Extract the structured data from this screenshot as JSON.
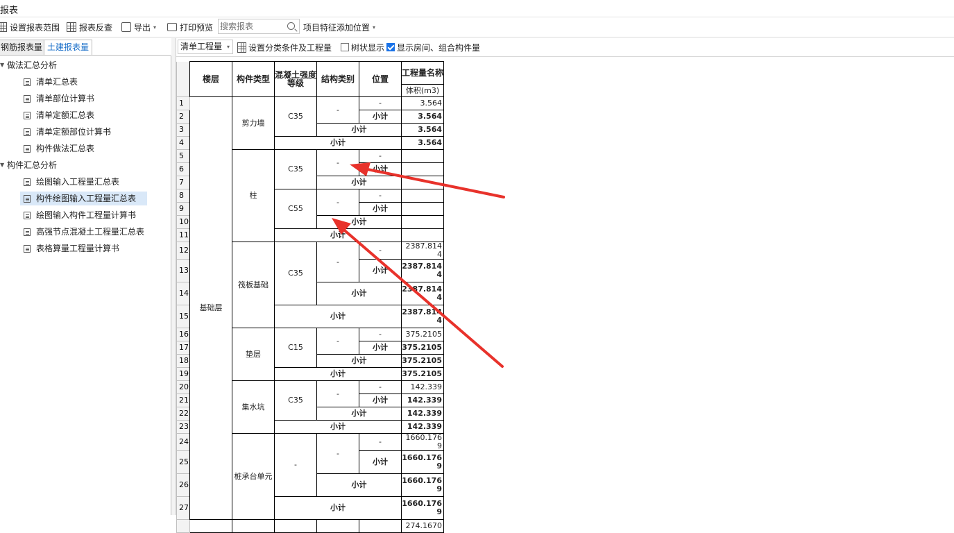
{
  "window": {
    "title": "报表"
  },
  "toolbar": {
    "set_range": "设置报表范围",
    "check": "报表反查",
    "export": "导出",
    "print": "打印预览",
    "search_placeholder": "搜索报表",
    "feature_pos": "项目特征添加位置"
  },
  "tabs": {
    "steel": "钢筋报表量",
    "civil": "土建报表量"
  },
  "tree": {
    "group1": "做法汇总分析",
    "g1_items": [
      "清单汇总表",
      "清单部位计算书",
      "清单定额汇总表",
      "清单定额部位计算书",
      "构件做法汇总表"
    ],
    "group2": "构件汇总分析",
    "g2_items": [
      "绘图输入工程量汇总表",
      "构件绘图输入工程量汇总表",
      "绘图输入构件工程量计算书",
      "高强节点混凝土工程量汇总表",
      "表格算量工程量计算书"
    ]
  },
  "report_toolbar": {
    "mode": "清单工程量",
    "set_filter": "设置分类条件及工程量",
    "tree_display": "树状显示",
    "tree_checked": false,
    "show_rooms": "显示房间、组合构件量",
    "rooms_checked": true
  },
  "table": {
    "headers": {
      "floor": "楼层",
      "type": "构件类型",
      "grade": "混凝土强度等级",
      "struct": "结构类别",
      "pos": "位置",
      "qty": "工程量名称",
      "unit": "体积(m3)"
    },
    "floor": "基础层",
    "dash": "-",
    "subtotal": "小计",
    "rows": [
      "1",
      "2",
      "3",
      "4",
      "5",
      "6",
      "7",
      "8",
      "9",
      "10",
      "11",
      "12",
      "13",
      "14",
      "15",
      "16",
      "17",
      "18",
      "19",
      "20",
      "21",
      "22",
      "23",
      "24",
      "25",
      "26",
      "27"
    ],
    "g1": {
      "type": "剪力墙",
      "grade": "C35",
      "v1": "3.564",
      "v2": "3.564",
      "v3": "3.564",
      "v4": "3.564"
    },
    "g2": {
      "type": "柱",
      "grade_a": "C35",
      "grade_b": "C55"
    },
    "g3": {
      "type": "筏板基础",
      "grade": "C35",
      "v1": "2387.8144",
      "v2": "2387.8144",
      "v3": "2387.8144",
      "v4": "2387.8144"
    },
    "g4": {
      "type": "垫层",
      "grade": "C15",
      "v1": "375.2105",
      "v2": "375.2105",
      "v3": "375.2105",
      "v4": "375.2105"
    },
    "g5": {
      "type": "集水坑",
      "grade": "C35",
      "v1": "142.339",
      "v2": "142.339",
      "v3": "142.339",
      "v4": "142.339"
    },
    "g6": {
      "type": "桩承台单元",
      "grade": "-",
      "v1": "1660.1769",
      "v2": "1660.1769",
      "v3": "1660.1769",
      "v4": "1660.1769"
    },
    "next_value": "274.1670"
  },
  "annotation": {
    "arrow_color": "#e8322b"
  }
}
